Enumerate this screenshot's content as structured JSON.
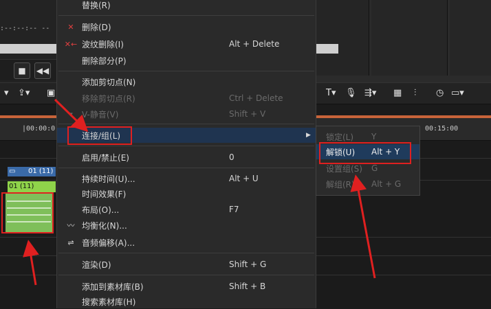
{
  "background": {
    "timecode": ":--:--:--   --",
    "ruler_left": "|00:00:0",
    "ruler_right": "00:15:00",
    "video_clip_label": "01 (11)",
    "audio_clip_label": "01 (11)"
  },
  "menu": {
    "items": [
      {
        "label": "替换(R)",
        "shortcut": ""
      },
      {
        "label": "删除(D)",
        "shortcut": ""
      },
      {
        "label": "波纹删除(I)",
        "shortcut": "Alt + Delete"
      },
      {
        "label": "删除部分(P)",
        "shortcut": ""
      },
      {
        "label": "添加剪切点(N)",
        "shortcut": ""
      },
      {
        "label": "移除剪切点(R)",
        "shortcut": "Ctrl + Delete"
      },
      {
        "label": "V-静音(V)",
        "shortcut": "Shift + V"
      },
      {
        "label": "连接/组(L)",
        "shortcut": ""
      },
      {
        "label": "启用/禁止(E)",
        "shortcut": "0"
      },
      {
        "label": "持续时间(U)...",
        "shortcut": "Alt + U"
      },
      {
        "label": "时间效果(F)",
        "shortcut": ""
      },
      {
        "label": "布局(O)...",
        "shortcut": "F7"
      },
      {
        "label": "均衡化(N)...",
        "shortcut": ""
      },
      {
        "label": "音频偏移(A)...",
        "shortcut": ""
      },
      {
        "label": "渲染(D)",
        "shortcut": "Shift + G"
      },
      {
        "label": "添加到素材库(B)",
        "shortcut": "Shift + B"
      },
      {
        "label": "搜索素材库(H)",
        "shortcut": ""
      }
    ]
  },
  "submenu": {
    "items": [
      {
        "label": "锁定(L)",
        "shortcut": "Y"
      },
      {
        "label": "解锁(U)",
        "shortcut": "Alt + Y"
      },
      {
        "label": "设置组(S)",
        "shortcut": "G"
      },
      {
        "label": "解组(R)",
        "shortcut": "Alt + G"
      }
    ]
  },
  "colors": {
    "menu_bg": "#2a2a2a",
    "highlight": "#1f3b5c",
    "annotation_red": "#e02020",
    "clip_green": "#8fd34a"
  }
}
